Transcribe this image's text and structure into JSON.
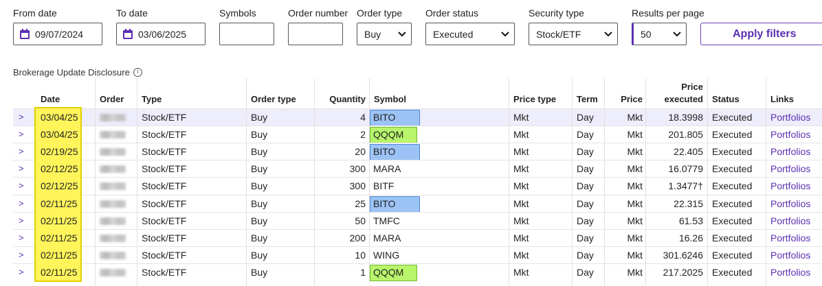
{
  "filters": {
    "from_date": {
      "label": "From date",
      "value": "09/07/2024"
    },
    "to_date": {
      "label": "To date",
      "value": "03/06/2025"
    },
    "symbols": {
      "label": "Symbols",
      "value": ""
    },
    "order_number": {
      "label": "Order number",
      "value": ""
    },
    "order_type": {
      "label": "Order type",
      "value": "Buy"
    },
    "order_status": {
      "label": "Order status",
      "value": "Executed"
    },
    "security_type": {
      "label": "Security type",
      "value": "Stock/ETF"
    },
    "results_per_page": {
      "label": "Results per page",
      "value": "50"
    },
    "apply_label": "Apply filters"
  },
  "disclosure": "Brokerage Update Disclosure",
  "table": {
    "headers": {
      "date": "Date",
      "order": "Order",
      "type": "Type",
      "order_type": "Order type",
      "quantity": "Quantity",
      "symbol": "Symbol",
      "price_type": "Price type",
      "term": "Term",
      "price": "Price",
      "price_executed_1": "Price",
      "price_executed_2": "executed",
      "status": "Status",
      "links": "Links"
    },
    "rows": [
      {
        "expander": ">",
        "date": "03/04/25",
        "type": "Stock/ETF",
        "order_type": "Buy",
        "quantity": "4",
        "symbol": "BITO",
        "price_type": "Mkt",
        "term": "Day",
        "price": "Mkt",
        "price_executed": "18.3998",
        "status": "Executed",
        "link": "Portfolios"
      },
      {
        "expander": ">",
        "date": "03/04/25",
        "type": "Stock/ETF",
        "order_type": "Buy",
        "quantity": "2",
        "symbol": "QQQM",
        "price_type": "Mkt",
        "term": "Day",
        "price": "Mkt",
        "price_executed": "201.805",
        "status": "Executed",
        "link": "Portfolios"
      },
      {
        "expander": ">",
        "date": "02/19/25",
        "type": "Stock/ETF",
        "order_type": "Buy",
        "quantity": "20",
        "symbol": "BITO",
        "price_type": "Mkt",
        "term": "Day",
        "price": "Mkt",
        "price_executed": "22.405",
        "status": "Executed",
        "link": "Portfolios"
      },
      {
        "expander": ">",
        "date": "02/12/25",
        "type": "Stock/ETF",
        "order_type": "Buy",
        "quantity": "300",
        "symbol": "MARA",
        "price_type": "Mkt",
        "term": "Day",
        "price": "Mkt",
        "price_executed": "16.0779",
        "status": "Executed",
        "link": "Portfolios"
      },
      {
        "expander": ">",
        "date": "02/12/25",
        "type": "Stock/ETF",
        "order_type": "Buy",
        "quantity": "300",
        "symbol": "BITF",
        "price_type": "Mkt",
        "term": "Day",
        "price": "Mkt",
        "price_executed": "1.3477†",
        "status": "Executed",
        "link": "Portfolios"
      },
      {
        "expander": ">",
        "date": "02/11/25",
        "type": "Stock/ETF",
        "order_type": "Buy",
        "quantity": "25",
        "symbol": "BITO",
        "price_type": "Mkt",
        "term": "Day",
        "price": "Mkt",
        "price_executed": "22.315",
        "status": "Executed",
        "link": "Portfolios"
      },
      {
        "expander": ">",
        "date": "02/11/25",
        "type": "Stock/ETF",
        "order_type": "Buy",
        "quantity": "50",
        "symbol": "TMFC",
        "price_type": "Mkt",
        "term": "Day",
        "price": "Mkt",
        "price_executed": "61.53",
        "status": "Executed",
        "link": "Portfolios"
      },
      {
        "expander": ">",
        "date": "02/11/25",
        "type": "Stock/ETF",
        "order_type": "Buy",
        "quantity": "200",
        "symbol": "MARA",
        "price_type": "Mkt",
        "term": "Day",
        "price": "Mkt",
        "price_executed": "16.26",
        "status": "Executed",
        "link": "Portfolios"
      },
      {
        "expander": ">",
        "date": "02/11/25",
        "type": "Stock/ETF",
        "order_type": "Buy",
        "quantity": "10",
        "symbol": "WING",
        "price_type": "Mkt",
        "term": "Day",
        "price": "Mkt",
        "price_executed": "301.6246",
        "status": "Executed",
        "link": "Portfolios"
      },
      {
        "expander": ">",
        "date": "02/11/25",
        "type": "Stock/ETF",
        "order_type": "Buy",
        "quantity": "1",
        "symbol": "QQQM",
        "price_type": "Mkt",
        "term": "Day",
        "price": "Mkt",
        "price_executed": "217.2025",
        "status": "Executed",
        "link": "Portfolios"
      }
    ]
  },
  "colors": {
    "accent": "#5b2fb0",
    "selected_row": "#eeedfb",
    "highlight_yellow": "#fff55a",
    "highlight_blue": "#9cc3f5",
    "highlight_green": "#b8f56a"
  },
  "highlights": {
    "blue_symbols": [
      "BITO"
    ],
    "green_symbols": [
      "QQQM"
    ]
  }
}
